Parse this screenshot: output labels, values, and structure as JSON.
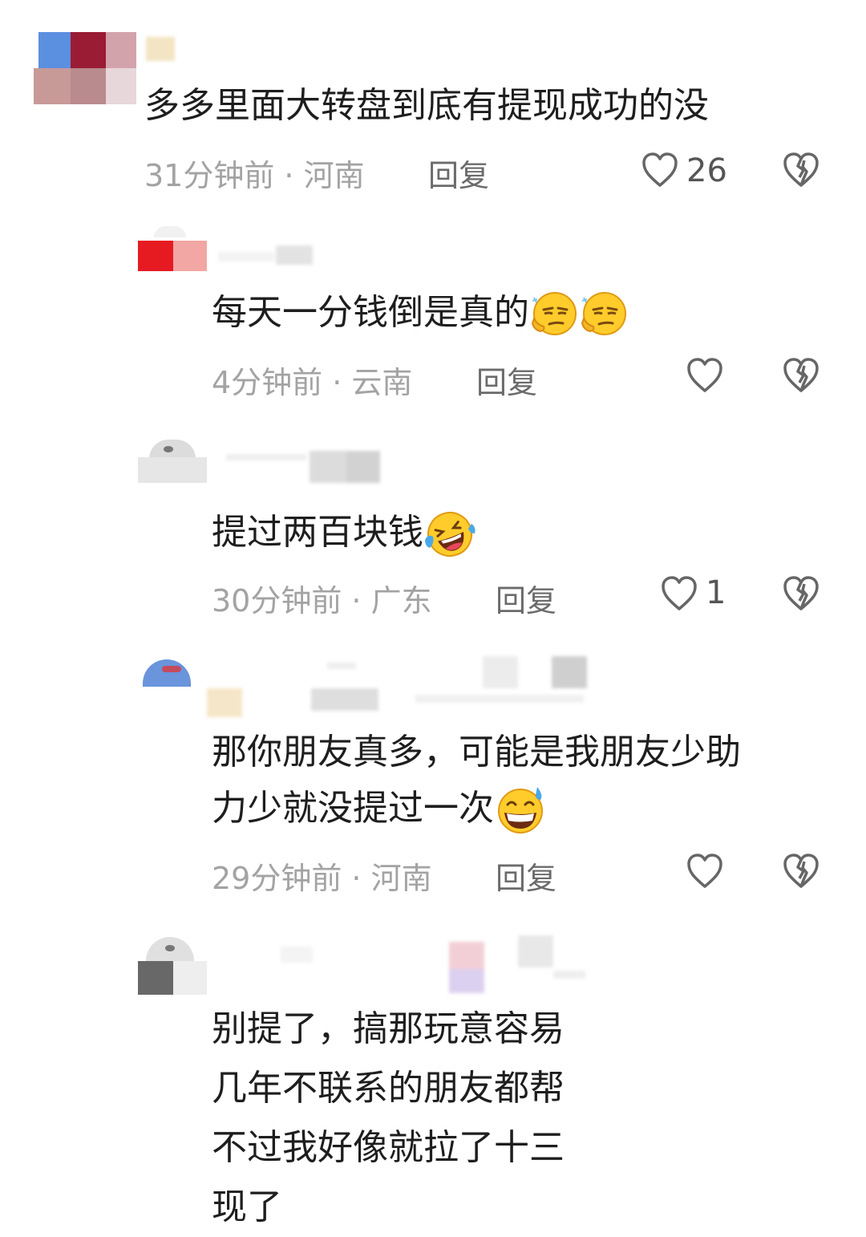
{
  "comments": [
    {
      "text": "多多里面大转盘到底有提现成功的没",
      "time_location": "31分钟前 · 河南",
      "reply_label": "回复",
      "like_count": "26"
    },
    {
      "text": "每天一分钱倒是真的",
      "time_location": "4分钟前 · 云南",
      "reply_label": "回复",
      "like_count": ""
    },
    {
      "text": "提过两百块钱",
      "time_location": "30分钟前 · 广东",
      "reply_label": "回复",
      "like_count": "1"
    },
    {
      "text_line1": "那你朋友真多，可能是我朋友少助",
      "text_line2": "力少就没提过一次",
      "time_location": "29分钟前 · 河南",
      "reply_label": "回复",
      "like_count": ""
    },
    {
      "lines": [
        "别提了，搞那玩意容易",
        "几年不联系的朋友都帮",
        "不过我好像就拉了十三",
        "现了"
      ]
    }
  ],
  "icons": {
    "like": "heart-outline-icon",
    "dislike": "broken-heart-icon",
    "emoji_smug": "smug-face-emoji",
    "emoji_laugh_cry": "rolling-laughing-emoji",
    "emoji_sweat_smile": "grinning-sweat-emoji"
  },
  "colors": {
    "text": "#1e1e1e",
    "meta": "#a3a3a3",
    "reply": "#6b6b6b",
    "icon": "#666666"
  }
}
